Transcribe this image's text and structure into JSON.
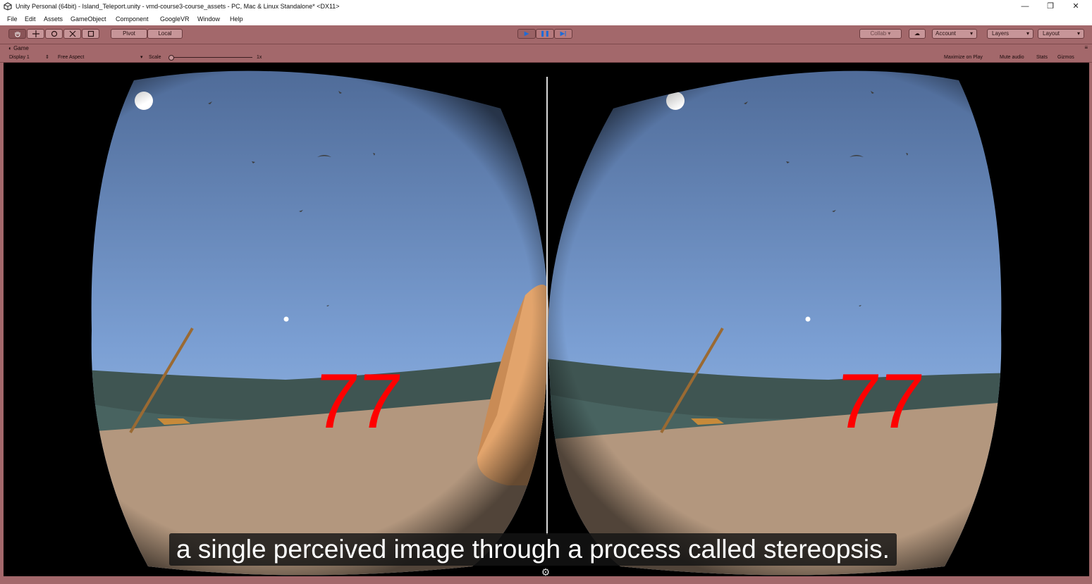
{
  "window": {
    "title": "Unity Personal (64bit) - Island_Teleport.unity - vmd-course3-course_assets - PC, Mac & Linux Standalone* <DX11>",
    "controls": {
      "minimize": "—",
      "restore": "❐",
      "close": "✕"
    }
  },
  "menu": [
    "File",
    "Edit",
    "Assets",
    "GameObject",
    "Component",
    "GoogleVR",
    "Window",
    "Help"
  ],
  "toolbar": {
    "tools": [
      "hand-icon",
      "move-icon",
      "rotate-icon",
      "scale-icon",
      "rect-icon"
    ],
    "pivot": "Pivot",
    "local": "Local",
    "play": "▶",
    "pause": "❚❚",
    "step": "▶|",
    "collab": "Collab ▾",
    "cloud": "☁",
    "account": "Account",
    "layers": "Layers",
    "layout": "Layout"
  },
  "game_tab": {
    "label": "Game",
    "display": "Display 1",
    "aspect": "Free Aspect",
    "scale_label": "Scale",
    "scale_value": "1x",
    "maximize": "Maximize on Play",
    "mute": "Mute audio",
    "stats": "Stats",
    "gizmos": "Gizmos"
  },
  "scene": {
    "score": "77",
    "score_color": "#ff0000",
    "sky_top": "#4e6a97",
    "sky_bottom": "#9fc3ee",
    "sand": "#b3977e",
    "sea": "#3f5552"
  },
  "caption": "a single perceived image through a process called stereopsis.",
  "icons": {
    "settings": "gear-icon",
    "unity": "unity-logo-icon"
  }
}
